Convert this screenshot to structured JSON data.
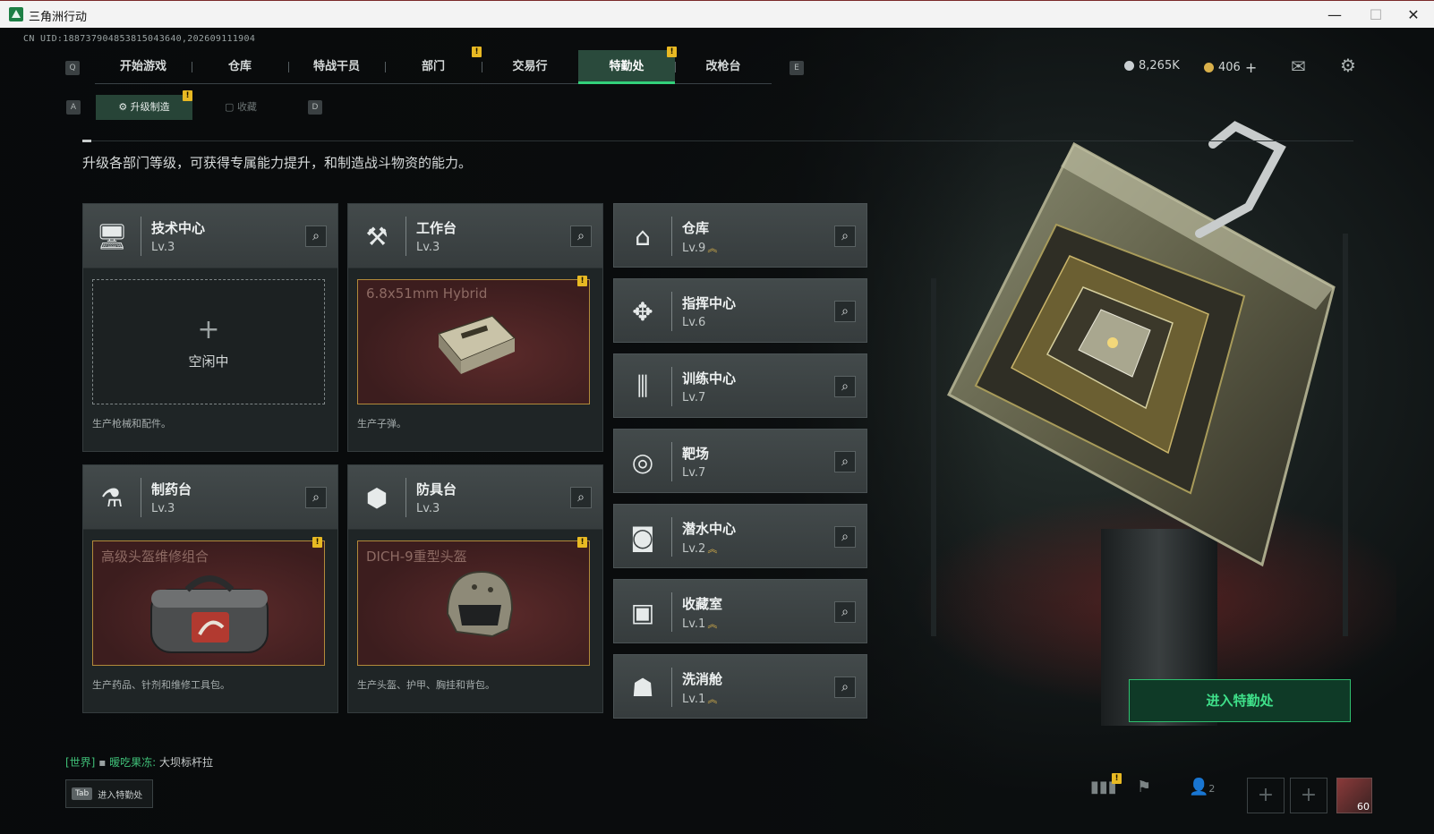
{
  "window": {
    "title": "三角洲行动",
    "minimize": "—",
    "maximize": "☐",
    "close": "✕"
  },
  "uid": "CN UID:1887379048538150436​40,202609111904",
  "nav": {
    "key_left": "Q",
    "key_right": "E",
    "tabs": [
      {
        "label": "开始游戏"
      },
      {
        "label": "仓库"
      },
      {
        "label": "特战干员"
      },
      {
        "label": "部门",
        "alert": "!"
      },
      {
        "label": "交易行"
      },
      {
        "label": "特勤处",
        "alert": "!"
      },
      {
        "label": "改枪台"
      }
    ]
  },
  "currency": {
    "silver": "8,265K",
    "gold": "406",
    "gold_add": "+"
  },
  "subnav": {
    "key_left": "A",
    "key_right": "D",
    "tabs": [
      {
        "label": "升级制造",
        "alert": "!"
      },
      {
        "label": "收藏"
      }
    ]
  },
  "description": "升级各部门等级，可获得专属能力提升，和制造战斗物资的能力。",
  "workshops": [
    {
      "name": "技术中心",
      "level": "Lv.3",
      "state": "空闲中",
      "plus": "+",
      "footer": "生产枪械和配件。"
    },
    {
      "name": "工作台",
      "level": "Lv.3",
      "item": "6.8x51mm Hybrid",
      "alert": "!",
      "footer": "生产子弹。"
    },
    {
      "name": "制药台",
      "level": "Lv.3",
      "item": "高级头盔维修组合",
      "alert": "!",
      "footer": "生产药品、针剂和维修工具包。"
    },
    {
      "name": "防具台",
      "level": "Lv.3",
      "item": "DICH-9重型头盔",
      "alert": "!",
      "footer": "生产头盔、护甲、胸挂和背包。"
    }
  ],
  "facilities": [
    {
      "name": "仓库",
      "level": "Lv.9",
      "upgrade": "︽"
    },
    {
      "name": "指挥中心",
      "level": "Lv.6",
      "upgrade": ""
    },
    {
      "name": "训练中心",
      "level": "Lv.7",
      "upgrade": ""
    },
    {
      "name": "靶场",
      "level": "Lv.7",
      "upgrade": ""
    },
    {
      "name": "潜水中心",
      "level": "Lv.2",
      "upgrade": "︽"
    },
    {
      "name": "收藏室",
      "level": "Lv.1",
      "upgrade": "︽"
    },
    {
      "name": "洗消舱",
      "level": "Lv.1",
      "upgrade": "︽"
    }
  ],
  "enter_button": "进入特勤处",
  "chat": {
    "channel": "[世界]",
    "user": "暧吃果冻:",
    "message": "大坝标杆拉"
  },
  "tab_hint": {
    "key": "Tab",
    "label": "进入特勤处"
  },
  "bottom": {
    "friends_count": "2",
    "alert": "!",
    "avatar_level": "60",
    "add": "+"
  },
  "colors": {
    "accent_green": "#33d17a",
    "alert_yellow": "#e8b923",
    "craft_red": "#3c1d1e"
  }
}
